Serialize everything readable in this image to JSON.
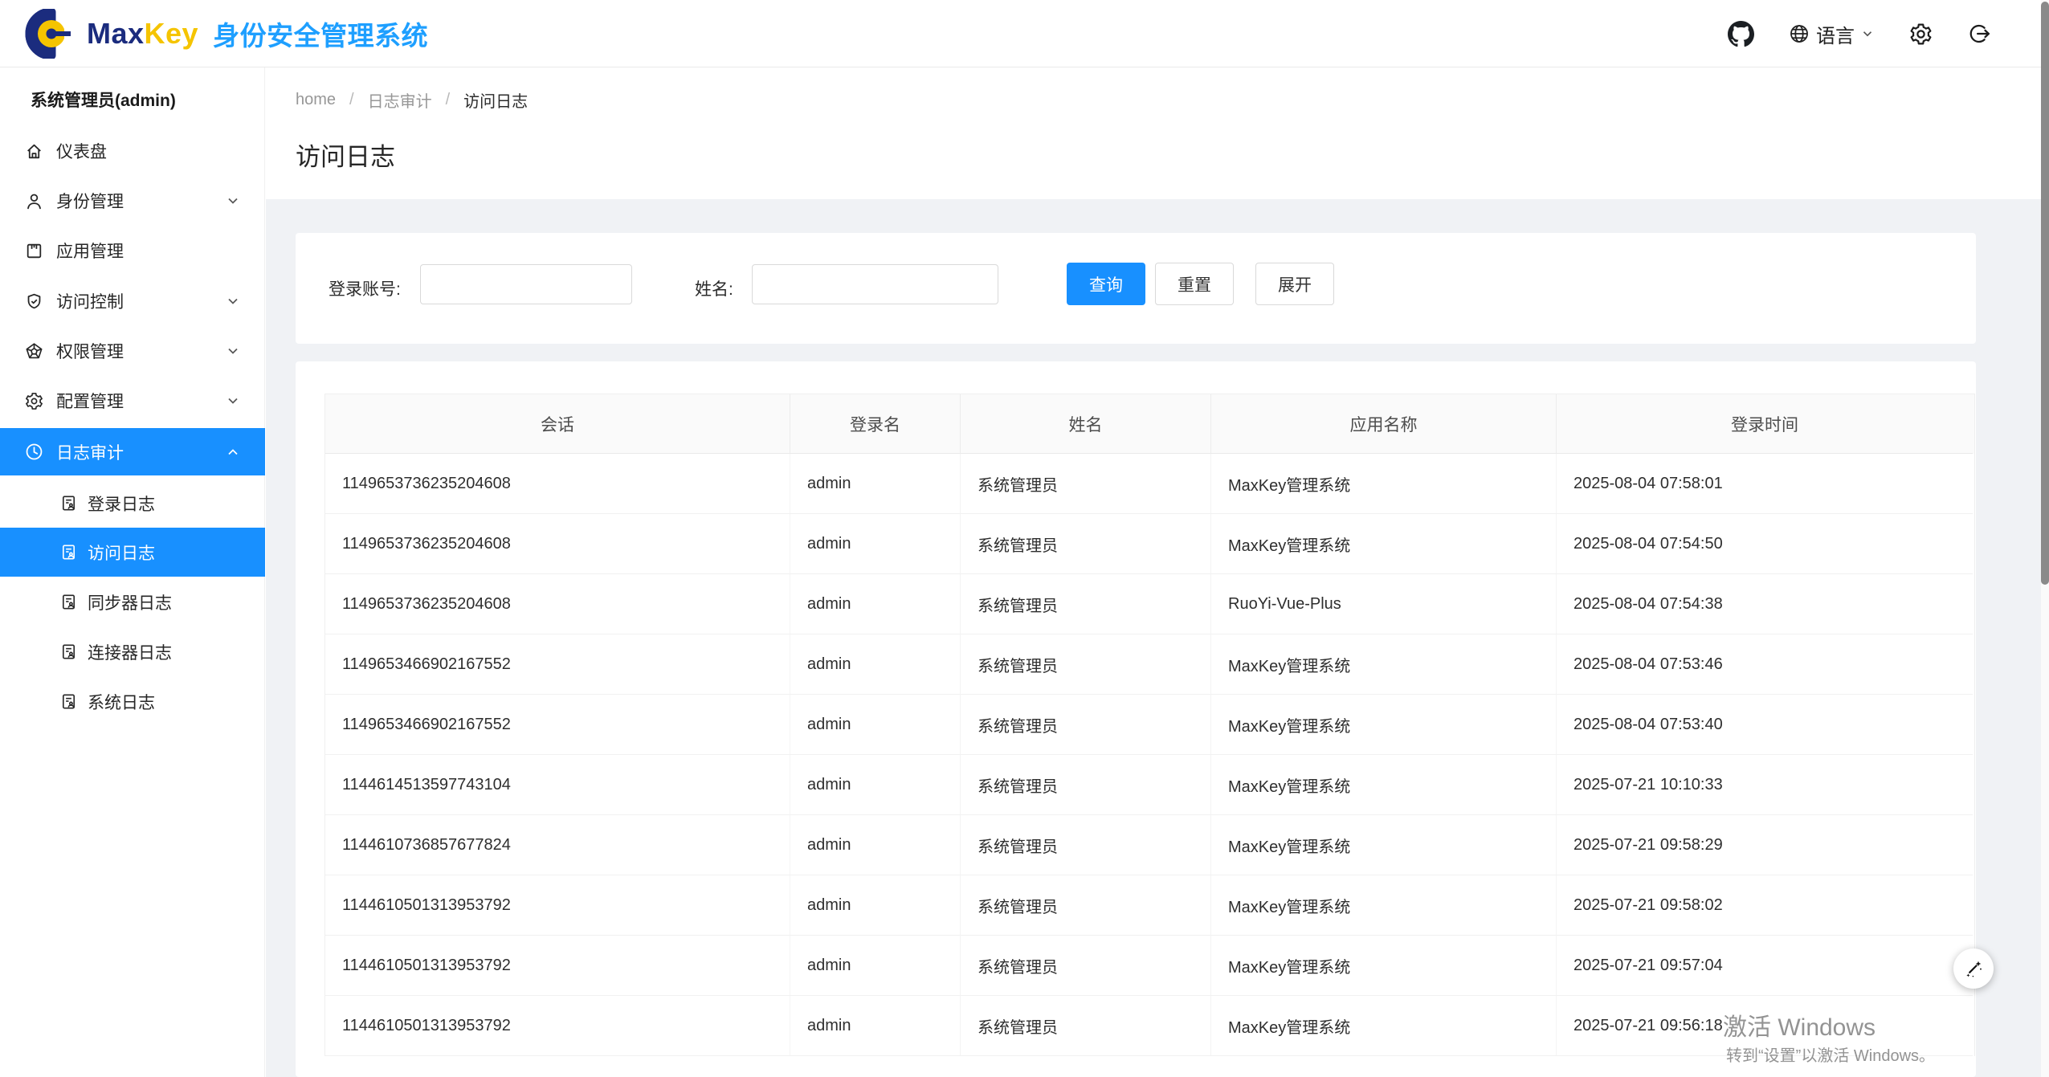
{
  "brand": {
    "word_max": "Max",
    "word_key": "Key",
    "subtitle": "身份安全管理系统"
  },
  "topbar": {
    "language_label": "语言"
  },
  "sidebar": {
    "user": "系统管理员(admin)",
    "items": [
      {
        "label": "仪表盘"
      },
      {
        "label": "身份管理"
      },
      {
        "label": "应用管理"
      },
      {
        "label": "访问控制"
      },
      {
        "label": "权限管理"
      },
      {
        "label": "配置管理"
      },
      {
        "label": "日志审计"
      }
    ],
    "subitems": [
      {
        "label": "登录日志"
      },
      {
        "label": "访问日志"
      },
      {
        "label": "同步器日志"
      },
      {
        "label": "连接器日志"
      },
      {
        "label": "系统日志"
      }
    ]
  },
  "breadcrumb": {
    "home": "home",
    "section": "日志审计",
    "current": "访问日志",
    "separator": "/"
  },
  "page": {
    "title": "访问日志"
  },
  "search": {
    "account_label": "登录账号:",
    "account_value": "",
    "name_label": "姓名:",
    "name_value": "",
    "buttons": {
      "query": "查询",
      "reset": "重置",
      "expand": "展开"
    }
  },
  "table": {
    "columns": [
      "会话",
      "登录名",
      "姓名",
      "应用名称",
      "登录时间"
    ],
    "rows": [
      [
        "1149653736235204608",
        "admin",
        "系统管理员",
        "MaxKey管理系统",
        "2025-08-04 07:58:01"
      ],
      [
        "1149653736235204608",
        "admin",
        "系统管理员",
        "MaxKey管理系统",
        "2025-08-04 07:54:50"
      ],
      [
        "1149653736235204608",
        "admin",
        "系统管理员",
        "RuoYi-Vue-Plus",
        "2025-08-04 07:54:38"
      ],
      [
        "1149653466902167552",
        "admin",
        "系统管理员",
        "MaxKey管理系统",
        "2025-08-04 07:53:46"
      ],
      [
        "1149653466902167552",
        "admin",
        "系统管理员",
        "MaxKey管理系统",
        "2025-08-04 07:53:40"
      ],
      [
        "1144614513597743104",
        "admin",
        "系统管理员",
        "MaxKey管理系统",
        "2025-07-21 10:10:33"
      ],
      [
        "1144610736857677824",
        "admin",
        "系统管理员",
        "MaxKey管理系统",
        "2025-07-21 09:58:29"
      ],
      [
        "1144610501313953792",
        "admin",
        "系统管理员",
        "MaxKey管理系统",
        "2025-07-21 09:58:02"
      ],
      [
        "1144610501313953792",
        "admin",
        "系统管理员",
        "MaxKey管理系统",
        "2025-07-21 09:57:04"
      ],
      [
        "1144610501313953792",
        "admin",
        "系统管理员",
        "MaxKey管理系统",
        "2025-07-21 09:56:18"
      ]
    ]
  },
  "watermark": {
    "line1": "激活 Windows",
    "line2": "转到“设置”以激活 Windows。"
  },
  "colors": {
    "accent": "#1890ff",
    "brand_navy": "#1b2c7e",
    "brand_gold": "#f5c400",
    "brand_blue": "#1e9fff",
    "page_bg": "#f0f2f5",
    "table_header_bg": "#fafafa",
    "input_border": "#d9d9d9"
  }
}
